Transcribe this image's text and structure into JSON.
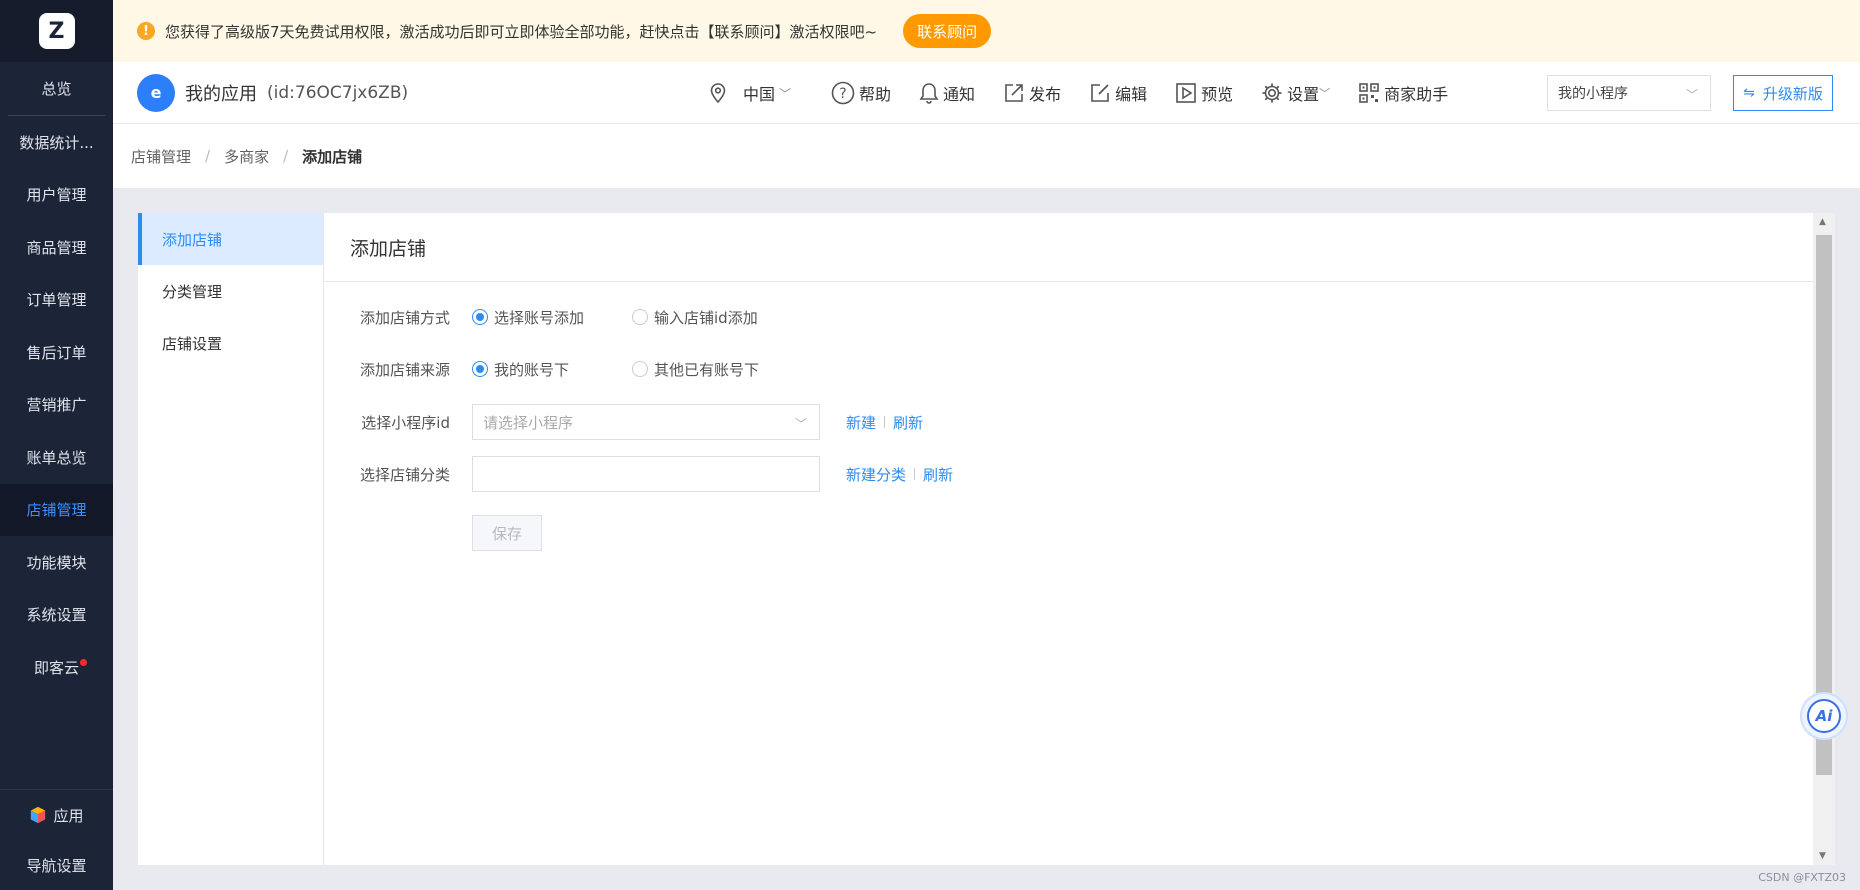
{
  "colors": {
    "sidebar_bg": "#1c2438",
    "accent": "#2d8cf0",
    "banner_bg": "#fff8e6",
    "banner_button": "#ff9900",
    "badge_dot": "#ff2a2a"
  },
  "sidebar": {
    "items": [
      {
        "label": "总览"
      },
      {
        "label": "数据统计..."
      },
      {
        "label": "用户管理"
      },
      {
        "label": "商品管理"
      },
      {
        "label": "订单管理"
      },
      {
        "label": "售后订单"
      },
      {
        "label": "营销推广"
      },
      {
        "label": "账单总览"
      },
      {
        "label": "店铺管理",
        "active": true
      },
      {
        "label": "功能模块"
      },
      {
        "label": "系统设置"
      },
      {
        "label": "即客云",
        "badge": true
      }
    ],
    "bottom": {
      "apps_label": "应用",
      "nav_settings_label": "导航设置"
    }
  },
  "banner": {
    "text": "您获得了高级版7天免费试用权限，激活成功后即可立即体验全部功能，赶快点击【联系顾问】激活权限吧~",
    "button_label": "联系顾问"
  },
  "header": {
    "app_name": "我的应用",
    "app_id": "(id:76OC7jx6ZB)",
    "region": "中国",
    "items": {
      "help": "帮助",
      "notify": "通知",
      "publish": "发布",
      "edit": "编辑",
      "preview": "预览",
      "settings": "设置",
      "merchant": "商家助手"
    },
    "miniprogram_select": "我的小程序",
    "upgrade_label": "升级新版"
  },
  "breadcrumb": {
    "level1": "店铺管理",
    "level2": "多商家",
    "current": "添加店铺"
  },
  "subnav": {
    "items": [
      "添加店铺",
      "分类管理",
      "店铺设置"
    ],
    "active_index": 0
  },
  "form": {
    "title": "添加店铺",
    "method": {
      "label": "添加店铺方式",
      "options": [
        "选择账号添加",
        "输入店铺id添加"
      ],
      "selected": 0
    },
    "source": {
      "label": "添加店铺来源",
      "options": [
        "我的账号下",
        "其他已有账号下"
      ],
      "selected": 0
    },
    "miniprogram": {
      "label": "选择小程序id",
      "placeholder": "请选择小程序",
      "link_new": "新建",
      "link_refresh": "刷新"
    },
    "category": {
      "label": "选择店铺分类",
      "value": "",
      "link_new": "新建分类",
      "link_refresh": "刷新"
    },
    "save_label": "保存"
  },
  "ai_button": {
    "label": "Ai"
  },
  "watermark": "CSDN @FXTZ03"
}
